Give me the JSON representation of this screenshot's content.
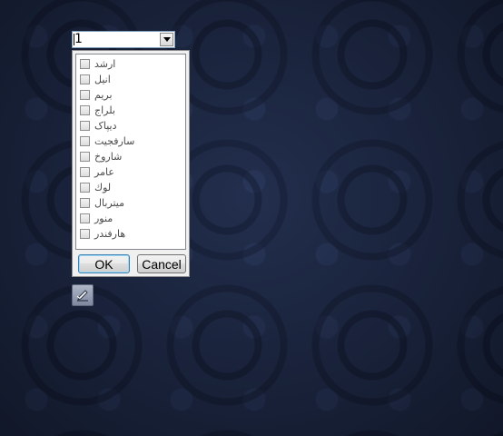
{
  "combo": {
    "value": "1"
  },
  "list": {
    "items": [
      {
        "label": "ارشد",
        "checked": false
      },
      {
        "label": "انیل",
        "checked": false
      },
      {
        "label": "بریم",
        "checked": false
      },
      {
        "label": "بلراج",
        "checked": false
      },
      {
        "label": "دیپاک",
        "checked": false
      },
      {
        "label": "سارفجیت",
        "checked": false
      },
      {
        "label": "شاروخ",
        "checked": false
      },
      {
        "label": "عامر",
        "checked": false
      },
      {
        "label": "لوك",
        "checked": false
      },
      {
        "label": "میتربال",
        "checked": false
      },
      {
        "label": "منور",
        "checked": false
      },
      {
        "label": "هارفندر",
        "checked": false
      }
    ]
  },
  "buttons": {
    "ok": "OK",
    "cancel": "Cancel"
  },
  "icons": {
    "combo_button": "chevron-down-icon",
    "edit_tool": "edit-pencil-icon"
  },
  "colors": {
    "background": "#1f2a44",
    "panel": "#f0f0f0",
    "ok_border": "#3c7fb1"
  }
}
